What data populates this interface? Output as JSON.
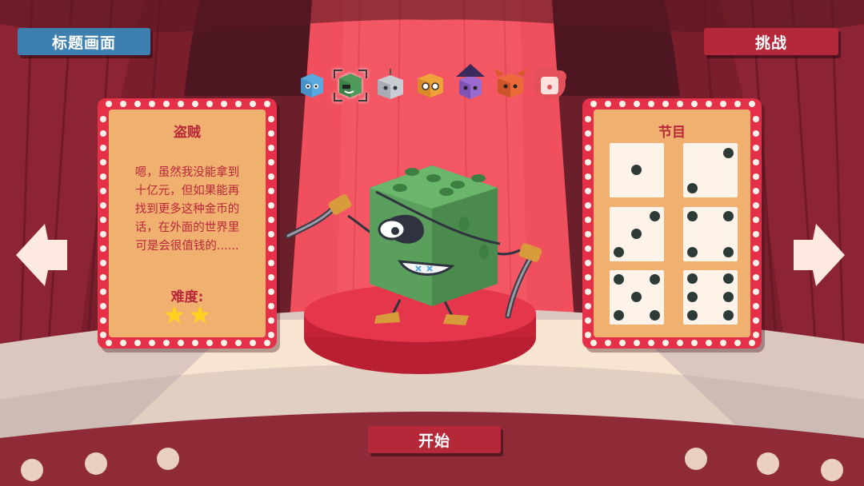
{
  "nav": {
    "title_screen_label": "标题画面",
    "challenge_label": "挑战",
    "start_label": "开始"
  },
  "character_selector": {
    "selected_index": 1,
    "characters": [
      {
        "icon": "blue-die-character-icon",
        "color": "#5aa8e0"
      },
      {
        "icon": "green-thief-die-character-icon",
        "color": "#4f9a5a"
      },
      {
        "icon": "robot-die-character-icon",
        "color": "#c9ccd2"
      },
      {
        "icon": "orange-glasses-die-character-icon",
        "color": "#f0a23a"
      },
      {
        "icon": "witch-die-character-icon",
        "color": "#9a6ad0"
      },
      {
        "icon": "jester-die-character-icon",
        "color": "#ec6a3a"
      },
      {
        "icon": "clown-die-character-icon",
        "color": "#e4505a"
      }
    ]
  },
  "character_card": {
    "name": "盗贼",
    "description_lines": [
      "嗯，虽然我没能拿到",
      "十亿元，但如果能再",
      "找到更多这种金币的",
      "话，在外面的世界里",
      "可是会很值钱的......"
    ],
    "difficulty_label": "难度:",
    "difficulty_stars": 2
  },
  "program_card": {
    "title": "节目",
    "dice_faces": [
      1,
      2,
      3,
      4,
      5,
      6
    ]
  },
  "featured_character": {
    "icon": "green-thief-die-with-daggers-icon",
    "color": "#5aa05c"
  },
  "colors": {
    "accent_red": "#e5304a",
    "card_bg": "#f0b070",
    "text_red": "#b8283a",
    "blue_button": "#3d7fae",
    "star": "#ffd21e"
  }
}
